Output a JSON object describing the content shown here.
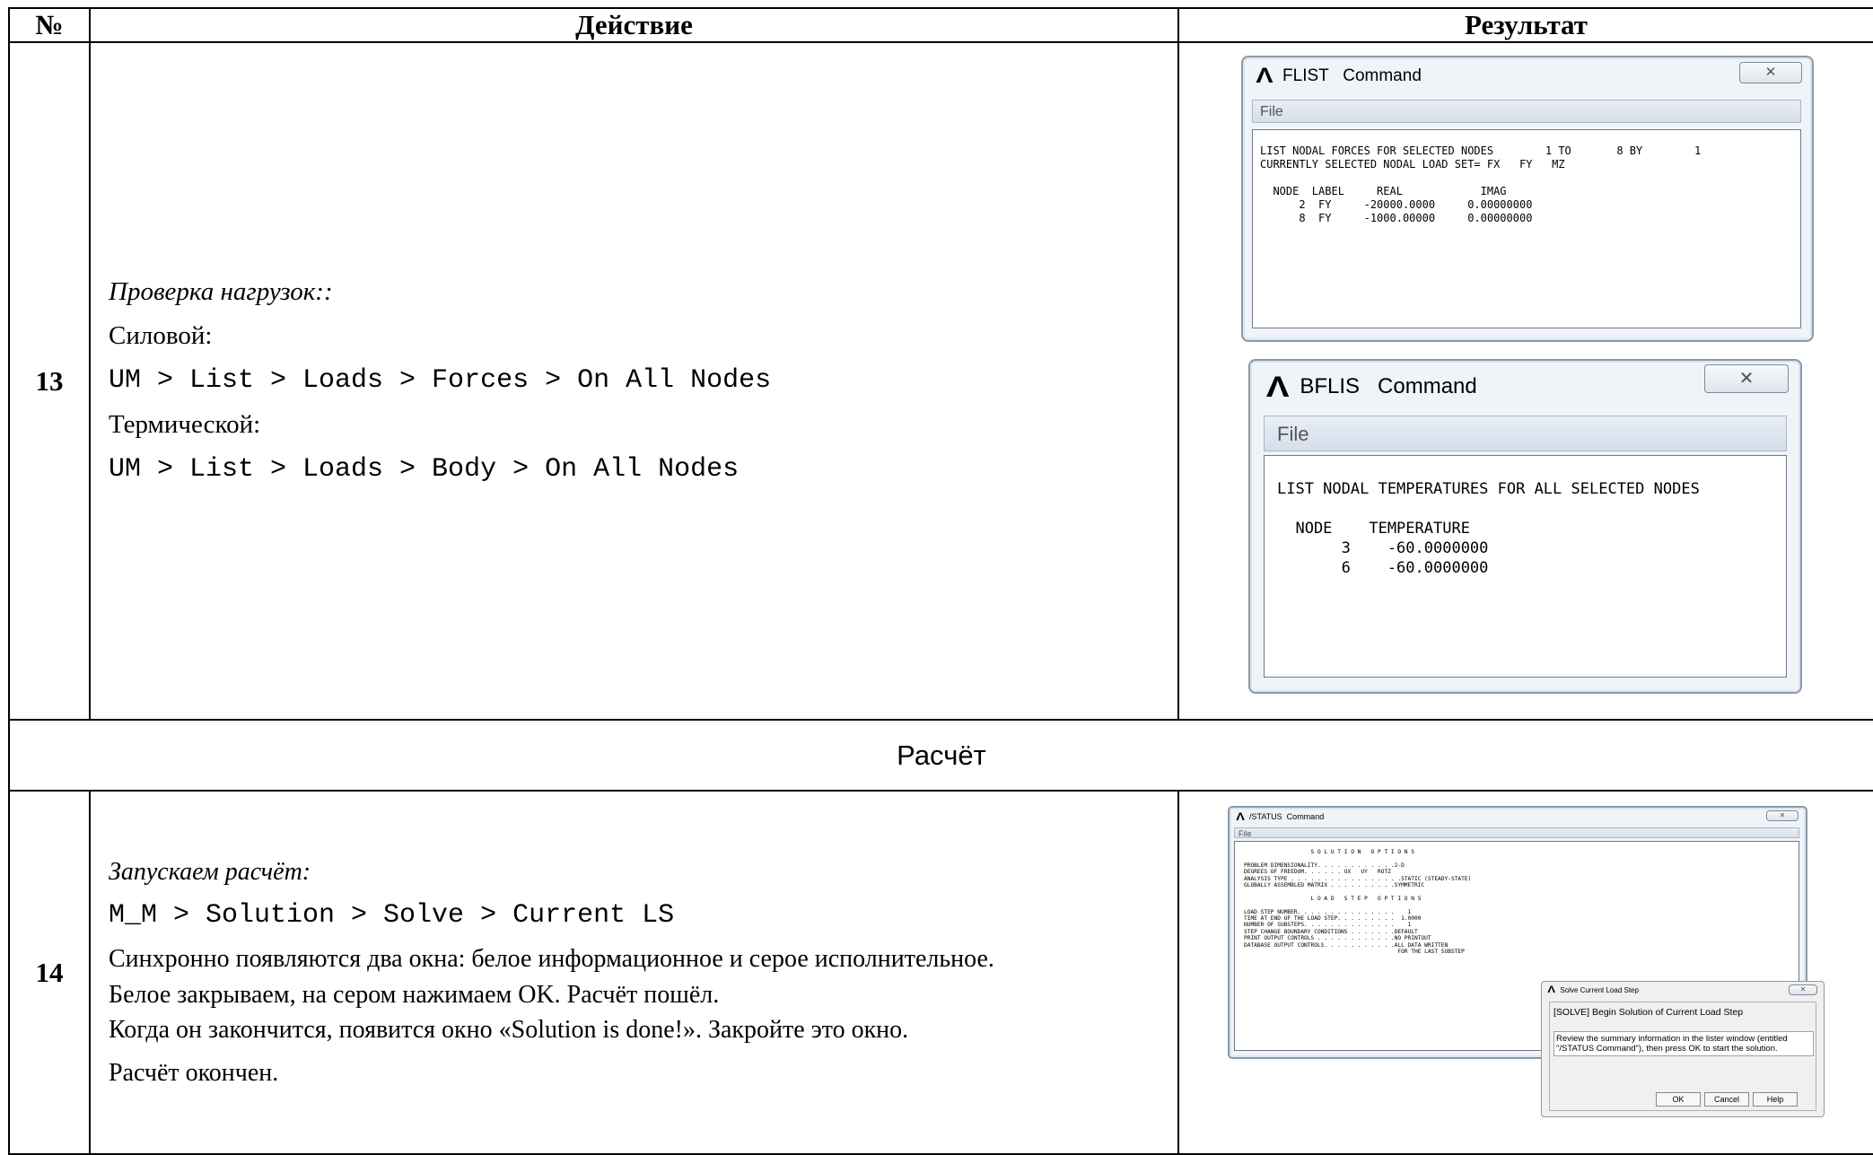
{
  "headers": {
    "num": "№",
    "action": "Действие",
    "result": "Результат"
  },
  "row13": {
    "num": "13",
    "title": "Проверка нагрузок::",
    "force_label": "Силовой:",
    "force_path": "UM > List > Loads > Forces > On All Nodes",
    "thermal_label": "Термической:",
    "thermal_path": "UM > List > Loads > Body > On All Nodes"
  },
  "section_title": "Расчёт",
  "row14": {
    "num": "14",
    "title": "Запускаем расчёт:",
    "path": "M_M > Solution > Solve > Current LS",
    "line1": "Синхронно появляются два окна: белое информационное и серое исполнительное.",
    "line2": "Белое закрываем, на сером нажимаем OK. Расчёт пошёл.",
    "line3": "Когда он закончится, появится окно «Solution is done!». Закройте это окно.",
    "line4": "Расчёт окончен."
  },
  "flist_window": {
    "logo": "Λ",
    "title": "FLIST   Command",
    "close": "✕",
    "menu": "File",
    "text": "LIST NODAL FORCES FOR SELECTED NODES        1 TO       8 BY        1\nCURRENTLY SELECTED NODAL LOAD SET= FX   FY   MZ\n\n  NODE  LABEL     REAL            IMAG\n      2  FY     -20000.0000     0.00000000\n      8  FY     -1000.00000     0.00000000"
  },
  "bflis_window": {
    "logo": "Λ",
    "title": "BFLIS   Command",
    "close": "✕",
    "menu": "File",
    "text": "LIST NODAL TEMPERATURES FOR ALL SELECTED NODES\n\n  NODE    TEMPERATURE\n       3    -60.0000000\n       6    -60.0000000"
  },
  "status_window": {
    "logo": "Λ",
    "title": "/STATUS  Command",
    "close": "✕",
    "menu": "File",
    "text": "                    S O L U T I O N   O P T I O N S\n\nPROBLEM DIMENSIONALITY. . . . . . . . . . . .2-D\nDEGREES OF FREEDOM. . . . . . UX   UY   ROTZ\nANALYSIS TYPE . . . . . . . . . . . . . . . . .STATIC (STEADY-STATE)\nGLOBALLY ASSEMBLED MATRIX . . . . . . . . . .SYMMETRIC\n\n                    L O A D   S T E P   O P T I O N S\n\nLOAD STEP NUMBER. . . . . . . . . . . . . . .    1\nTIME AT END OF THE LOAD STEP. . . . . . . . .  1.0000\nNUMBER OF SUBSTEPS. . . . . . . . . . . . . .    1\nSTEP CHANGE BOUNDARY CONDITIONS . . . . . . .DEFAULT\nPRINT OUTPUT CONTROLS . . . . . . . . . . . .NO PRINTOUT\nDATABASE OUTPUT CONTROLS. . . . . . . . . . .ALL DATA WRITTEN\n                                              FOR THE LAST SUBSTEP"
  },
  "solve_dialog": {
    "logo": "Λ",
    "title": "Solve Current Load Step",
    "close": "✕",
    "heading": "[SOLVE] Begin Solution of Current Load Step",
    "message": "Review the summary information in the lister window (entitled \"/STATUS Command\"), then press OK to start the solution.",
    "ok": "OK",
    "cancel": "Cancel",
    "help": "Help"
  }
}
